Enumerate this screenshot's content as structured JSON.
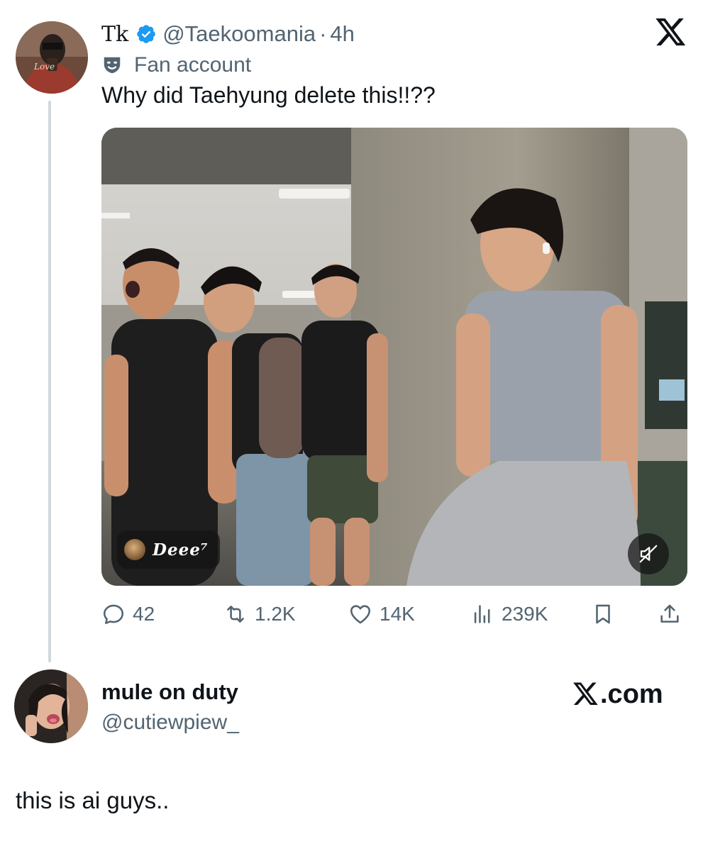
{
  "post": {
    "author_name": "Tk",
    "author_handle": "@Taekoomania",
    "separator": "·",
    "time": "4h",
    "account_label": "Fan account",
    "text": "Why did Taehyung delete this!!??",
    "media_watermark": "Deee⁷",
    "stats": {
      "replies": "42",
      "reposts": "1.2K",
      "likes": "14K",
      "views": "239K"
    },
    "avatar_text": "Love"
  },
  "reply_card": {
    "name": "mule on duty",
    "handle": "@cutiewpiew_",
    "site_label": ".com",
    "caption": "this is ai guys.."
  },
  "icons": {
    "verified": "verified-badge-icon",
    "fan_account": "theater-mask-icon",
    "platform": "x-logo-icon",
    "reply": "comment-icon",
    "repost": "repost-icon",
    "like": "heart-icon",
    "views": "views-bar-chart-icon",
    "bookmark": "bookmark-icon",
    "share": "share-upload-icon",
    "mute": "muted-speaker-icon"
  },
  "colors": {
    "verified_blue": "#1d9bf0",
    "secondary_text": "#536471",
    "primary_text": "#0f1419",
    "thread_line": "#cfd9de"
  }
}
